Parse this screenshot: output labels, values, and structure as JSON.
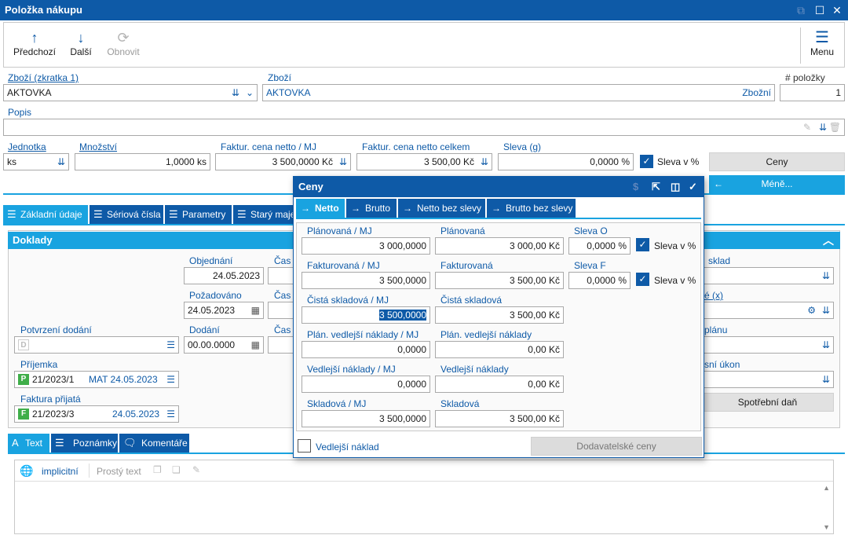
{
  "window": {
    "title": "Položka nákupu"
  },
  "toolbar": {
    "prev": "Předchozí",
    "next": "Další",
    "refresh": "Obnovit",
    "menu": "Menu"
  },
  "header": {
    "zbozi_short_label": "Zboží (zkratka 1)",
    "zbozi_short_value": "AKTOVKA",
    "zbozi_label": "Zboží",
    "zbozi_value": "AKTOVKA",
    "zbozi_suffix": "Zbožní",
    "polozky_label": "# položky",
    "polozky_value": "1",
    "popis_label": "Popis",
    "popis_value": "",
    "jednotka_label": "Jednotka",
    "jednotka_value": "ks",
    "mnozstvi_label": "Množství",
    "mnozstvi_value": "1,0000 ks",
    "cena_mj_label": "Faktur. cena netto / MJ",
    "cena_mj_value": "3 500,0000 Kč",
    "cena_celkem_label": "Faktur. cena netto celkem",
    "cena_celkem_value": "3 500,00 Kč",
    "sleva_label": "Sleva (g)",
    "sleva_value": "0,0000 %",
    "sleva_pct_label": "Sleva v %",
    "ceny_button": "Ceny",
    "mene_button": "Méně..."
  },
  "tabs": [
    "Základní údaje",
    "Sériová čísla",
    "Parametry",
    "Starý majetek"
  ],
  "doklady": {
    "title": "Doklady",
    "objednani_label": "Objednání",
    "objednani_value": "24.05.2023",
    "cas1": "Čas",
    "cas2": "Čas",
    "cas3": "Čas",
    "pozadovano_label": "Požadováno",
    "pozadovano_value": "24.05.2023",
    "dodani_label": "Dodání",
    "dodani_value": "00.00.0000",
    "potvrzeni_label": "Potvrzení dodání",
    "potvrzeni_badge": "D",
    "prijemka_label": "Příjemka",
    "prijemka_badge": "P",
    "prijemka_no": "21/2023/1",
    "prijemka_extra": "MAT 24.05.2023",
    "faktura_label": "Faktura přijatá",
    "faktura_badge": "F",
    "faktura_no": "21/2023/3",
    "faktura_date": "24.05.2023",
    "sklad_label": "sklad",
    "x_label": "é (x)",
    "planu_label": "plánu",
    "ukon_label": "sní úkon",
    "spotrebni_button": "Spotřební daň"
  },
  "texttabs": [
    "Text",
    "Poznámky",
    "Komentáře"
  ],
  "editor": {
    "lang": "implicitní",
    "style": "Prostý text"
  },
  "dialog": {
    "title": "Ceny",
    "tabs": [
      "Netto",
      "Brutto",
      "Netto bez slevy",
      "Brutto bez slevy"
    ],
    "planovana_mj_label": "Plánovaná / MJ",
    "planovana_mj_value": "3 000,0000",
    "planovana_label": "Plánovaná",
    "planovana_value": "3 000,00 Kč",
    "sleva_o_label": "Sleva O",
    "sleva_o_value": "0,0000 %",
    "sleva_pct1": "Sleva v %",
    "fakturovana_mj_label": "Fakturovaná / MJ",
    "fakturovana_mj_value": "3 500,0000",
    "fakturovana_label": "Fakturovaná",
    "fakturovana_value": "3 500,00 Kč",
    "sleva_f_label": "Sleva F",
    "sleva_f_value": "0,0000 %",
    "sleva_pct2": "Sleva v %",
    "cista_mj_label": "Čistá skladová / MJ",
    "cista_mj_value": "3 500,0000",
    "cista_label": "Čistá skladová",
    "cista_value": "3 500,00 Kč",
    "plan_vedl_mj_label": "Plán. vedlejší náklady / MJ",
    "plan_vedl_mj_value": "0,0000",
    "plan_vedl_label": "Plán. vedlejší náklady",
    "plan_vedl_value": "0,00 Kč",
    "vedl_mj_label": "Vedlejší náklady / MJ",
    "vedl_mj_value": "0,0000",
    "vedl_label": "Vedlejší náklady",
    "vedl_value": "0,00 Kč",
    "skladova_mj_label": "Skladová / MJ",
    "skladova_mj_value": "3 500,0000",
    "skladova_label": "Skladová",
    "skladova_value": "3 500,00 Kč",
    "vedlejsi_naklad_label": "Vedlejší náklad",
    "dodavatelske_button": "Dodavatelské ceny"
  },
  "colors": {
    "primary": "#0e5aa7",
    "accent": "#19a3e0"
  }
}
